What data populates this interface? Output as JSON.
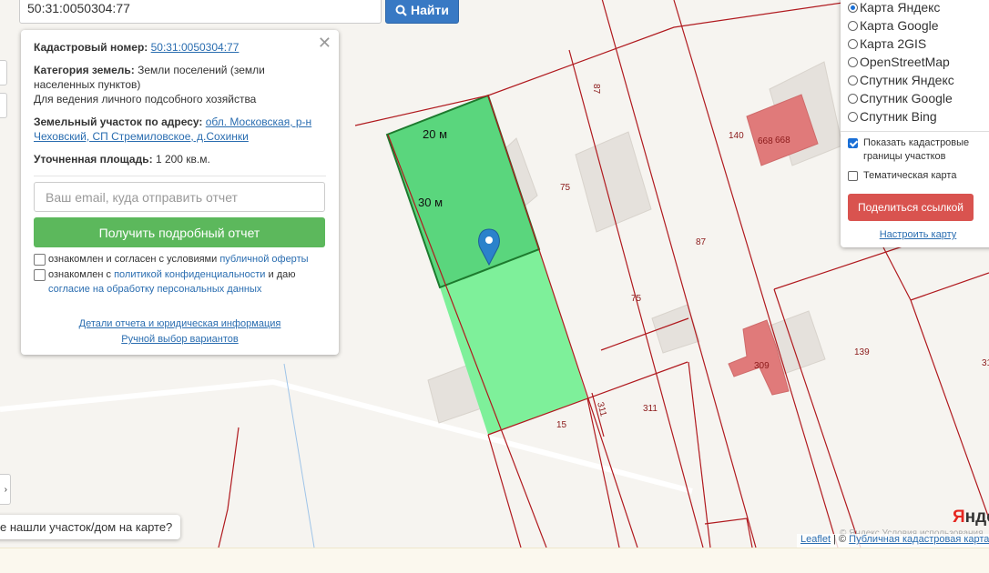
{
  "search": {
    "value": "50:31:0050304:77",
    "button_label": "Найти"
  },
  "info": {
    "cadastral_label": "Кадастровый номер:",
    "cadastral_value": "50:31:0050304:77",
    "category_label": "Категория земель:",
    "category_value": "Земли поселений (земли населенных пунктов)",
    "usage": "Для ведения личного подсобного хозяйства",
    "address_label": "Земельный участок по адресу:",
    "address_value": "обл. Московская, р-н Чеховский, СП Стремиловское, д.Сохинки",
    "area_label": "Уточненная площадь:",
    "area_value": "1 200 кв.м.",
    "email_placeholder": "Ваш email, куда отправить отчет",
    "report_button": "Получить подробный отчет",
    "agree1_text": "ознакомлен и согласен с условиями",
    "agree1_link": "публичной оферты",
    "agree2_text": "ознакомлен с",
    "agree2_link": "политикой конфиденциальности",
    "agree2_mid": "и даю",
    "agree2_link2": "согласие на обработку персональных данных",
    "details_link": "Детали отчета и юридическая информация",
    "manual_link": "Ручной выбор вариантов"
  },
  "map_layers": [
    {
      "label": "Карта Яндекс",
      "selected": true
    },
    {
      "label": "Карта Google",
      "selected": false
    },
    {
      "label": "Карта 2GIS",
      "selected": false
    },
    {
      "label": "OpenStreetMap",
      "selected": false
    },
    {
      "label": "Спутник Яндекс",
      "selected": false
    },
    {
      "label": "Спутник Google",
      "selected": false
    },
    {
      "label": "Спутник Bing",
      "selected": false
    }
  ],
  "options": {
    "show_borders": "Показать кадастровые границы участков",
    "show_borders_checked": true,
    "thematic": "Тематическая карта",
    "thematic_checked": false,
    "share_button": "Поделиться ссылкой",
    "setup_link": "Настроить карту"
  },
  "map": {
    "dim_width": "20 м",
    "dim_length": "30 м",
    "parcel_labels": [
      "87",
      "75",
      "87",
      "75",
      "140",
      "668",
      "668",
      "309",
      "139",
      "311",
      "311",
      "15",
      "31"
    ],
    "colors": {
      "parcel_selected": "#5ad67d",
      "parcel_adjacent": "#7ef09a",
      "border": "#b0191e",
      "building": "#e5e1dc",
      "building_red": "#e07a7a"
    }
  },
  "not_found": "е нашли участок/дом на карте?",
  "attribution": {
    "leaflet": "Leaflet",
    "sep": " | © ",
    "source": "Публичная кадастровая карта",
    "yandex": "Яндекс",
    "yandex_terms": "© Яндекс Условия использования"
  }
}
